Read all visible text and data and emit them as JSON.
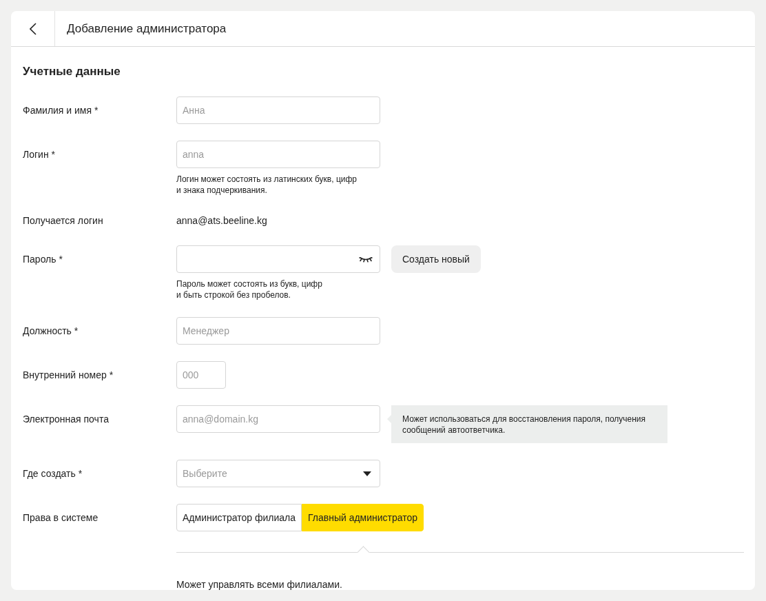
{
  "header": {
    "title": "Добавление администратора"
  },
  "section_title": "Учетные данные",
  "fields": [
    {
      "kind": "text",
      "label": "Фамилия и имя *",
      "placeholder": "Анна"
    },
    {
      "kind": "text",
      "label": "Логин *",
      "placeholder": "anna",
      "hint": "Логин может состоять из латинских букв, цифр\nи знака подчеркивания."
    },
    {
      "kind": "readonly",
      "label": "Получается логин",
      "value": "anna@ats.beeline.kg"
    },
    {
      "kind": "password",
      "label": "Пароль *",
      "button": "Создать новый",
      "hint": "Пароль может состоять из букв, цифр\nи быть строкой без пробелов."
    },
    {
      "kind": "text",
      "label": "Должность *",
      "placeholder": "Менеджер"
    },
    {
      "kind": "short",
      "label": "Внутренний номер *",
      "placeholder": "000"
    },
    {
      "kind": "text",
      "label": "Электронная почта",
      "placeholder": "anna@domain.kg",
      "tooltip": "Может использоваться для восстановления пароля, получения\nсообщений автоответчика."
    },
    {
      "kind": "select",
      "label": "Где создать *",
      "placeholder": "Выберите"
    },
    {
      "kind": "segmented",
      "label": "Права в системе",
      "options": [
        {
          "label": "Администратор филиала",
          "selected": false
        },
        {
          "label": "Главный администратор",
          "selected": true
        }
      ],
      "description": "Может управлять всеми филиалами."
    }
  ]
}
